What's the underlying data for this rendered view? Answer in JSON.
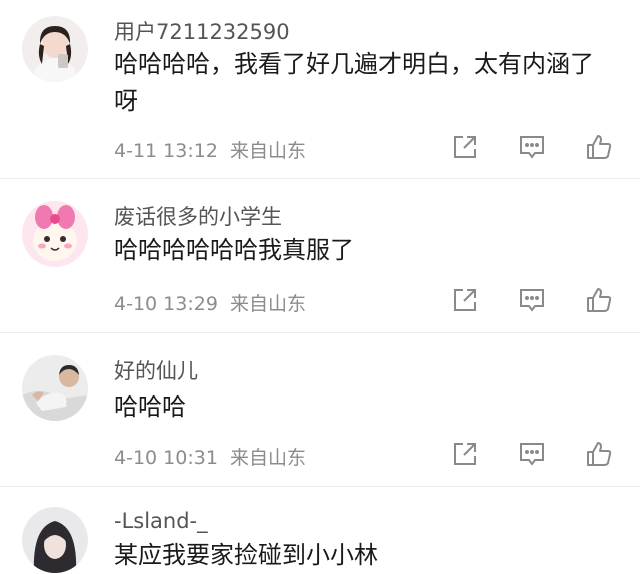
{
  "comments": [
    {
      "username": "用户7211232590",
      "text": "哈哈哈哈，我看了好几遍才明白，太有内涵了呀",
      "time": "4-11 13:12",
      "location": "来自山东",
      "avatar": "girl-selfie-avatar"
    },
    {
      "username": "废话很多的小学生",
      "text": "哈哈哈哈哈哈我真服了",
      "time": "4-10 13:29",
      "location": "来自山东",
      "avatar": "cartoon-bunny-avatar"
    },
    {
      "username": "好的仙儿",
      "text": "哈哈哈",
      "time": "4-10 10:31",
      "location": "来自山东",
      "avatar": "man-reclining-avatar"
    },
    {
      "username": "-Lsland-_",
      "text": "某应我要家捡碰到小小林",
      "avatar": "dark-hair-avatar"
    }
  ],
  "icons": {
    "share": "share-icon",
    "comment": "comment-icon",
    "like": "thumbs-up-icon"
  },
  "colors": {
    "text": "#1a1a1a",
    "username": "#555555",
    "meta": "#8c8c8c",
    "icon": "#8a8a8a"
  }
}
